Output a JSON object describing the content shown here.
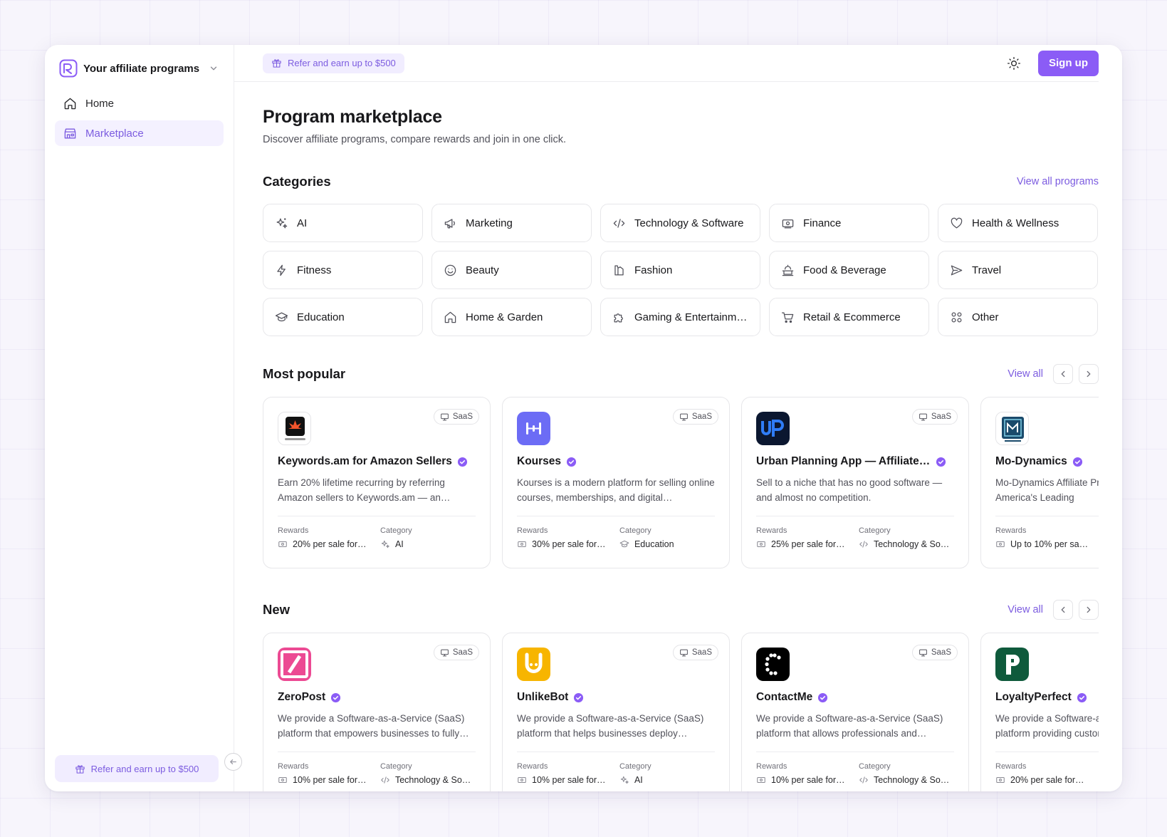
{
  "sidebar": {
    "workspace_title": "Your affiliate programs",
    "items": [
      {
        "label": "Home",
        "icon": "home-icon"
      },
      {
        "label": "Marketplace",
        "icon": "store-icon"
      }
    ],
    "refer_label": "Refer and earn up to $500"
  },
  "topbar": {
    "refer_label": "Refer and earn up to $500",
    "signup_label": "Sign up"
  },
  "page": {
    "title": "Program marketplace",
    "subtitle": "Discover affiliate programs, compare rewards and join in one click."
  },
  "categories": {
    "title": "Categories",
    "view_all": "View all programs",
    "items": [
      {
        "label": "AI",
        "icon": "sparkles-icon"
      },
      {
        "label": "Marketing",
        "icon": "megaphone-icon"
      },
      {
        "label": "Technology & Software",
        "icon": "code-icon"
      },
      {
        "label": "Finance",
        "icon": "banknote-icon"
      },
      {
        "label": "Health & Wellness",
        "icon": "heart-icon"
      },
      {
        "label": "Fitness",
        "icon": "lightning-icon"
      },
      {
        "label": "Beauty",
        "icon": "smile-icon"
      },
      {
        "label": "Fashion",
        "icon": "hanger-icon"
      },
      {
        "label": "Food & Beverage",
        "icon": "cooking-pot-icon"
      },
      {
        "label": "Travel",
        "icon": "send-icon"
      },
      {
        "label": "Education",
        "icon": "graduation-cap-icon"
      },
      {
        "label": "Home & Garden",
        "icon": "home-icon"
      },
      {
        "label": "Gaming & Entertainment",
        "icon": "puzzle-icon"
      },
      {
        "label": "Retail & Ecommerce",
        "icon": "cart-icon"
      },
      {
        "label": "Other",
        "icon": "grid-icon"
      }
    ]
  },
  "labels": {
    "rewards": "Rewards",
    "category": "Category",
    "saas": "SaaS"
  },
  "popular": {
    "title": "Most popular",
    "view_all": "View all",
    "cards": [
      {
        "name": "Keywords.am for Amazon Sellers",
        "logo": "keywords-logo",
        "desc": "Earn 20% lifetime recurring by referring Amazon sellers to Keywords.am — an…",
        "reward": "20% per sale for…",
        "category": "AI",
        "category_icon": "sparkles-icon"
      },
      {
        "name": "Kourses",
        "logo": "kourses-logo",
        "desc": "Kourses is a modern platform for selling online courses, memberships, and digital…",
        "reward": "30% per sale for…",
        "category": "Education",
        "category_icon": "graduation-cap-icon"
      },
      {
        "name": "Urban Planning App — Affiliate P…",
        "logo": "up-logo",
        "desc": "Sell to a niche that has no good software — and almost no competition.",
        "reward": "25% per sale for…",
        "category": "Technology & So…",
        "category_icon": "code-icon"
      },
      {
        "name": "Mo-Dynamics",
        "logo": "modynamics-logo",
        "desc": "Mo-Dynamics Affiliate Program North America's Leading",
        "reward": "Up to 10% per sa…",
        "category": "",
        "category_icon": ""
      }
    ]
  },
  "new": {
    "title": "New",
    "view_all": "View all",
    "cards": [
      {
        "name": "ZeroPost",
        "logo": "zeropost-logo",
        "desc": "We provide a Software-as-a-Service (SaaS) platform that empowers businesses to fully…",
        "reward": "10% per sale fore…",
        "category": "Technology & So…",
        "category_icon": "code-icon"
      },
      {
        "name": "UnlikeBot",
        "logo": "unlikebot-logo",
        "desc": "We provide a Software-as-a-Service (SaaS) platform that helps businesses deploy…",
        "reward": "10% per sale fore…",
        "category": "AI",
        "category_icon": "sparkles-icon"
      },
      {
        "name": "ContactMe",
        "logo": "contactme-logo",
        "desc": "We provide a Software-as-a-Service (SaaS) platform that allows professionals and…",
        "reward": "10% per sale fore…",
        "category": "Technology & So…",
        "category_icon": "code-icon"
      },
      {
        "name": "LoyaltyPerfect",
        "logo": "loyaltyperfect-logo",
        "desc": "We provide a Software-as-a-Service (SaaS) platform providing custom",
        "reward": "20% per sale for…",
        "category": "",
        "category_icon": ""
      }
    ]
  },
  "colors": {
    "accent": "#8b5cf6",
    "accent_text": "#7c5ce0",
    "accent_bg": "#f1edff",
    "verified": "#8b5cf6"
  }
}
